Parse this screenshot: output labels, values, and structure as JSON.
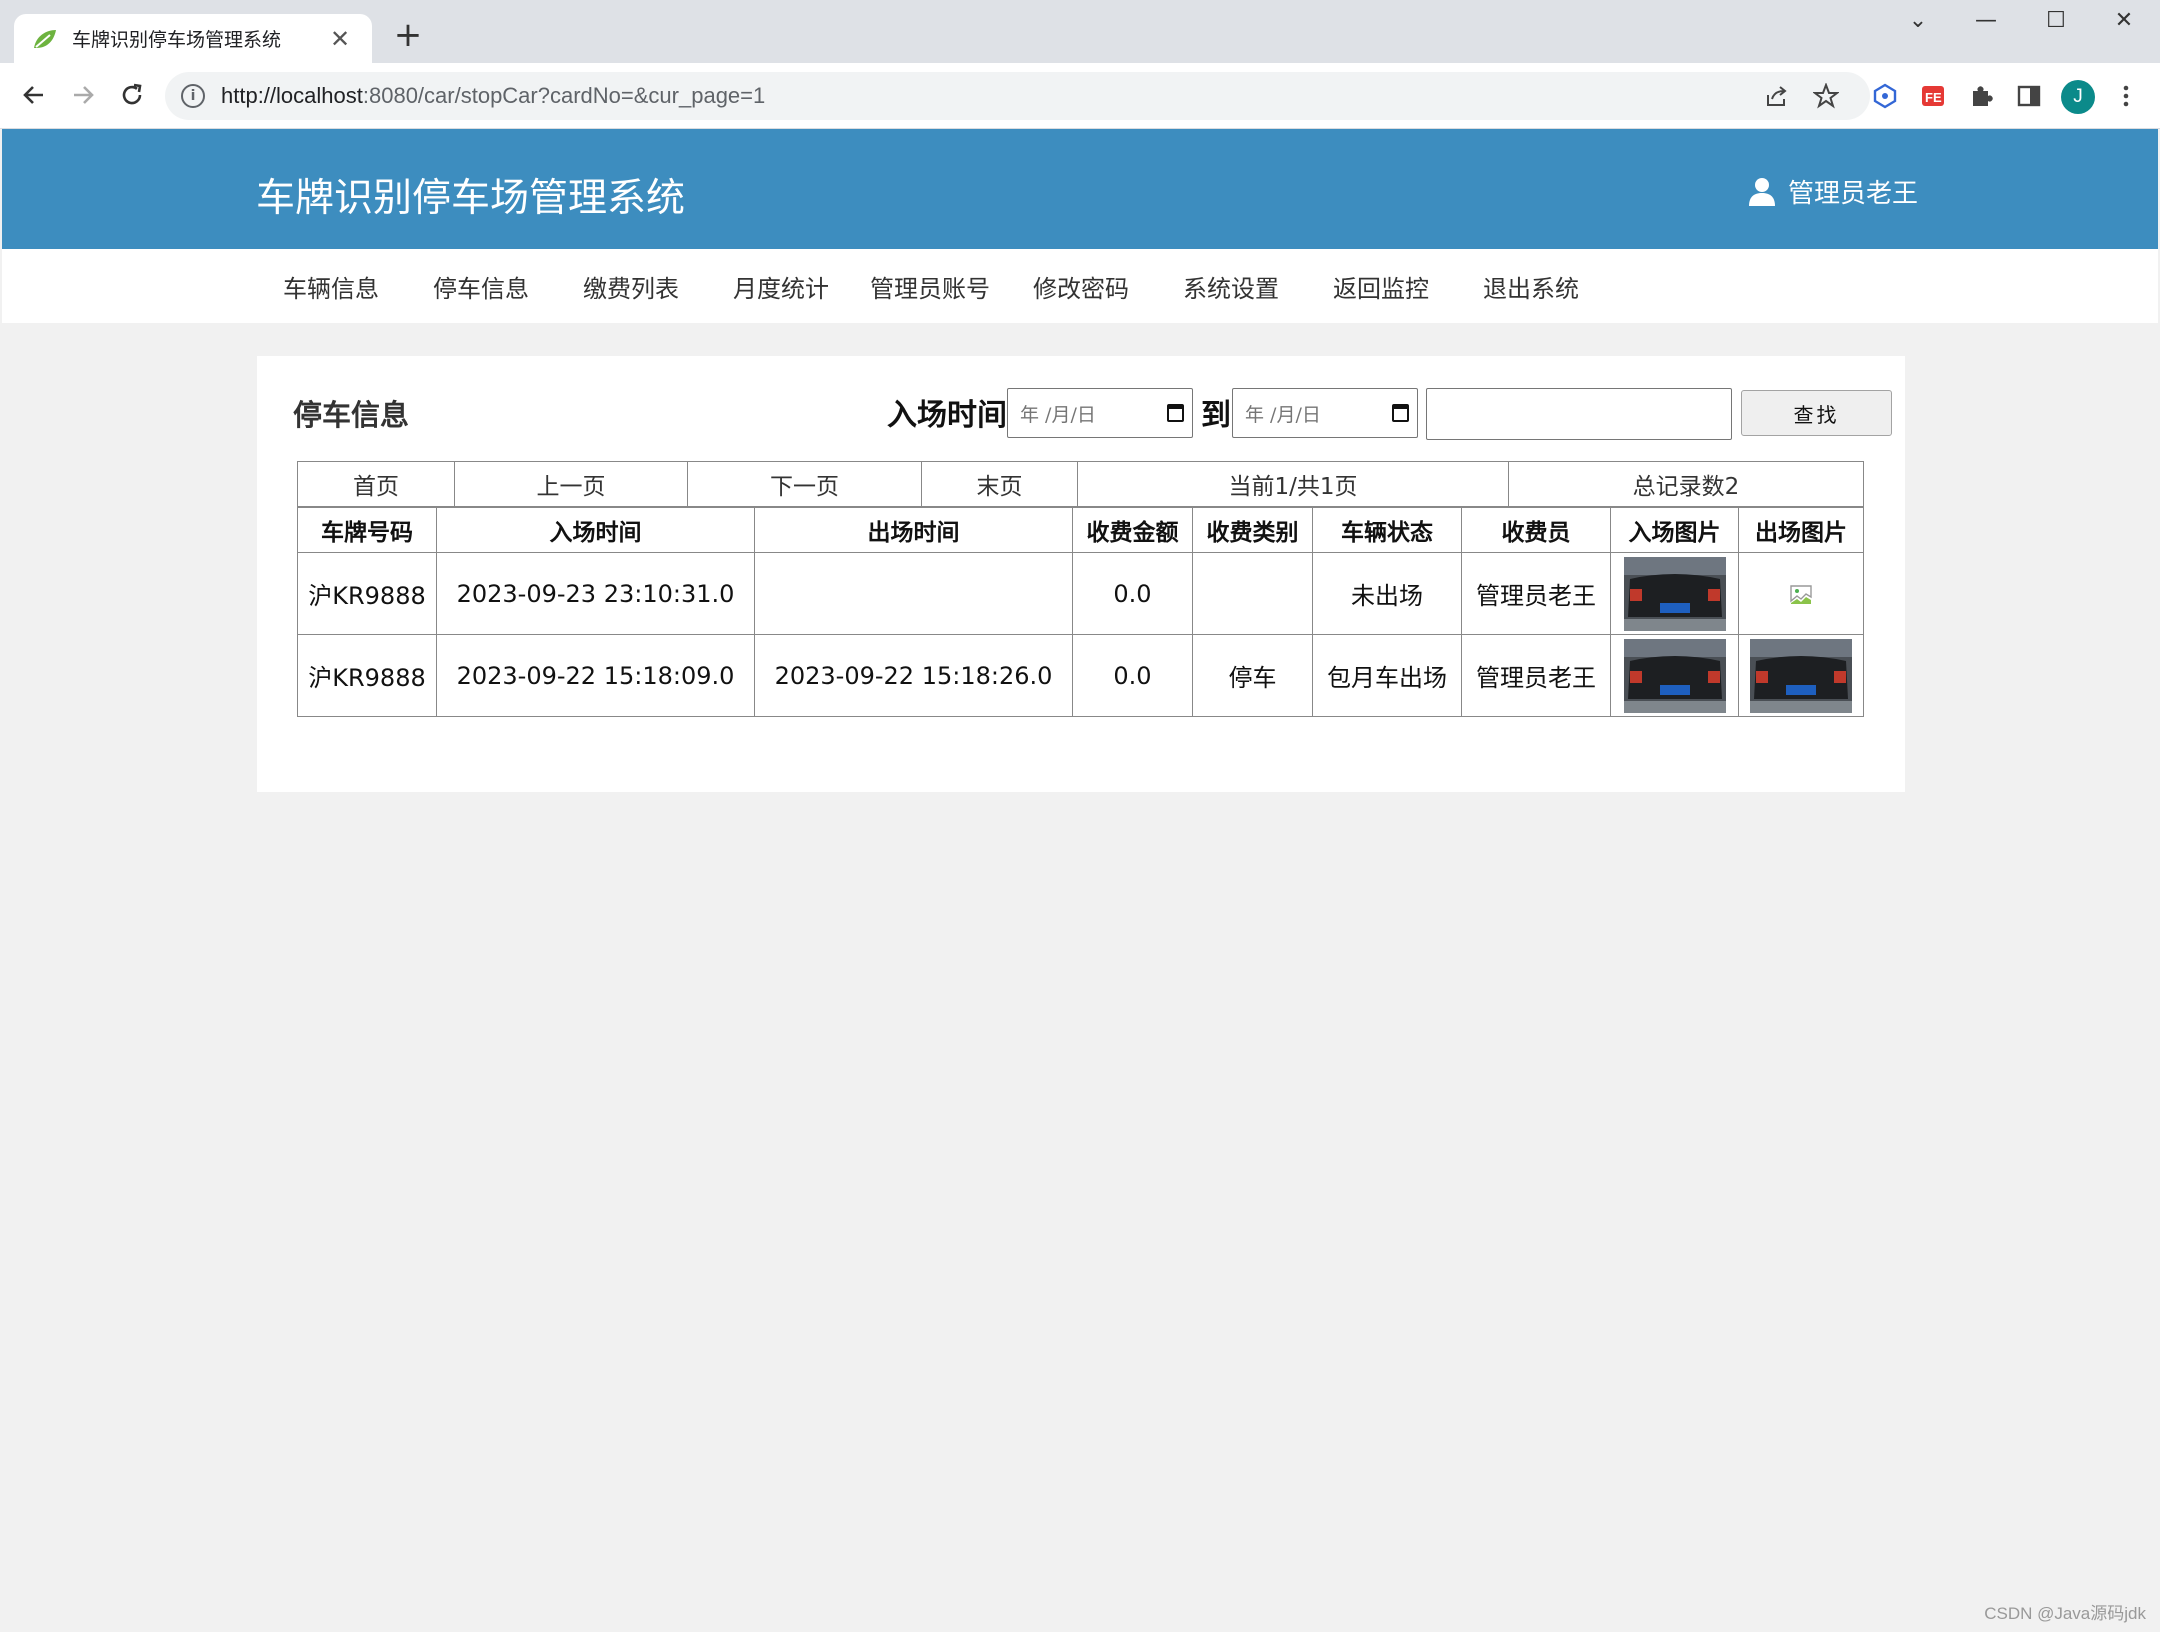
{
  "browser": {
    "tab_title": "车牌识别停车场管理系统",
    "url_host": "http://localhost",
    "url_rest": ":8080/car/stopCar?cardNo=&cur_page=1",
    "profile_initial": "J"
  },
  "header": {
    "site_title": "车牌识别停车场管理系统",
    "user_label": "管理员老王"
  },
  "nav": {
    "items": [
      "车辆信息",
      "停车信息",
      "缴费列表",
      "月度统计",
      "管理员账号",
      "修改密码",
      "系统设置",
      "返回监控",
      "退出系统"
    ]
  },
  "panel": {
    "title": "停车信息",
    "filter_label": "入场时间",
    "to_label": "到",
    "date_placeholder": "年 /月/日",
    "search_button": "查找"
  },
  "pager": {
    "first": "首页",
    "prev": "上一页",
    "next": "下一页",
    "last": "末页",
    "current": "当前1/共1页",
    "total": "总记录数2"
  },
  "table": {
    "headers": [
      "车牌号码",
      "入场时间",
      "出场时间",
      "收费金额",
      "收费类别",
      "车辆状态",
      "收费员",
      "入场图片",
      "出场图片"
    ],
    "rows": [
      {
        "plate": "沪KR9888",
        "in_time": "2023-09-23 23:10:31.0",
        "out_time": "",
        "fee": "0.0",
        "fee_type": "",
        "status": "未出场",
        "cashier": "管理员老王"
      },
      {
        "plate": "沪KR9888",
        "in_time": "2023-09-22 15:18:09.0",
        "out_time": "2023-09-22 15:18:26.0",
        "fee": "0.0",
        "fee_type": "停车",
        "status": "包月车出场",
        "cashier": "管理员老王"
      }
    ]
  },
  "watermark": "CSDN @Java源码jdk",
  "colors": {
    "header_bg": "#3d8dbf",
    "page_bg": "#f1f1f1"
  }
}
